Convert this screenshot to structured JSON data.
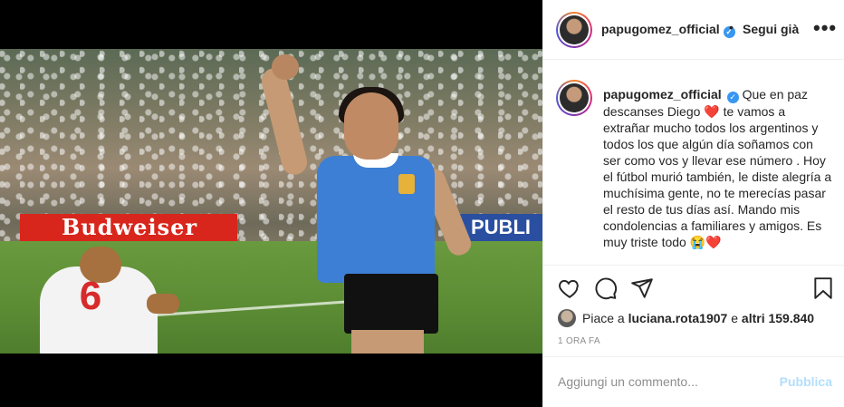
{
  "post": {
    "author": "papugomez_official",
    "follow_separator": "•",
    "follow_label": "Segui già",
    "more_label": "•••"
  },
  "caption": {
    "username": "papugomez_official",
    "part1": "Que en paz descanses Diego",
    "part2": "te vamos a extrañar mucho todos los argentinos y todos los que algún día soñamos con ser como vos y llevar ese número . Hoy el fútbol murió también, le diste alegría a muchísima gente, no te merecías pasar el resto de tus días así. Mando mis condolencias a familiares y amigos. Es muy triste todo",
    "emoji_heart": "❤️",
    "emoji_cry": "😭",
    "emoji_heart_end": "❤️"
  },
  "likes": {
    "prefix": "Piace a",
    "user": "luciana.rota1907",
    "middle": "e",
    "count": "altri 159.840"
  },
  "timestamp": "1 ORA FA",
  "comment": {
    "placeholder": "Aggiungi un commento...",
    "publish_label": "Pubblica"
  },
  "photo": {
    "banner_text": "Budweiser",
    "banner2_text": "PUBLI",
    "jersey_number": "6"
  },
  "icons": [
    "heart-icon",
    "comment-icon",
    "share-icon",
    "bookmark-icon",
    "verified-icon"
  ],
  "colors": {
    "accent_blue": "#3897f0",
    "publish_disabled": "#b2dffc",
    "heart_red": "#e0245e"
  }
}
